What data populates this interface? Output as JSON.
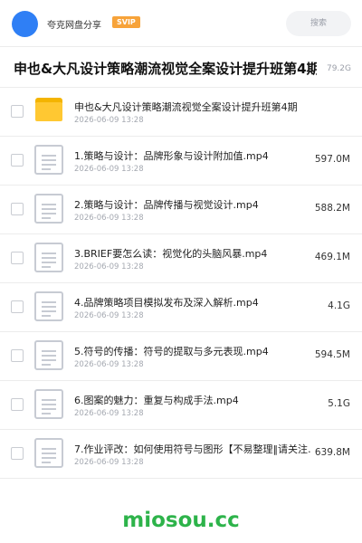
{
  "header": {
    "brand": "夸克网盘分享",
    "badge": "SVIP",
    "search_label": "搜索"
  },
  "folder_title": "申也&大凡设计策略潮流视觉全案设计提升班第4期",
  "folder_size": "79.2G",
  "items": [
    {
      "name": "申也&大凡设计策略潮流视觉全案设计提升班第4期",
      "date": "2026-06-09 13:28",
      "size": "",
      "type": "folder"
    },
    {
      "name": "1.策略与设计：品牌形象与设计附加值.mp4",
      "date": "2026-06-09 13:28",
      "size": "597.0M",
      "type": "file"
    },
    {
      "name": "2.策略与设计：品牌传播与视觉设计.mp4",
      "date": "2026-06-09 13:28",
      "size": "588.2M",
      "type": "file"
    },
    {
      "name": "3.BRIEF要怎么读：视觉化的头脑风暴.mp4",
      "date": "2026-06-09 13:28",
      "size": "469.1M",
      "type": "file"
    },
    {
      "name": "4.品牌策略项目模拟发布及深入解析.mp4",
      "date": "2026-06-09 13:28",
      "size": "4.1G",
      "type": "file"
    },
    {
      "name": "5.符号的传播：符号的提取与多元表现.mp4",
      "date": "2026-06-09 13:28",
      "size": "594.5M",
      "type": "file"
    },
    {
      "name": "6.图案的魅力：重复与构成手法.mp4",
      "date": "2026-06-09 13:28",
      "size": "5.1G",
      "type": "file"
    },
    {
      "name": "7.作业评改：如何使用符号与图形【不易整理‖请关注…",
      "date": "2026-06-09 13:28",
      "size": "639.8M",
      "type": "file"
    }
  ],
  "watermark": "miosou.cc",
  "colors": {
    "accent": "#2f7ff5",
    "badge": "#f7a33a",
    "folder": "#ffc832",
    "watermark": "#2db34a"
  }
}
